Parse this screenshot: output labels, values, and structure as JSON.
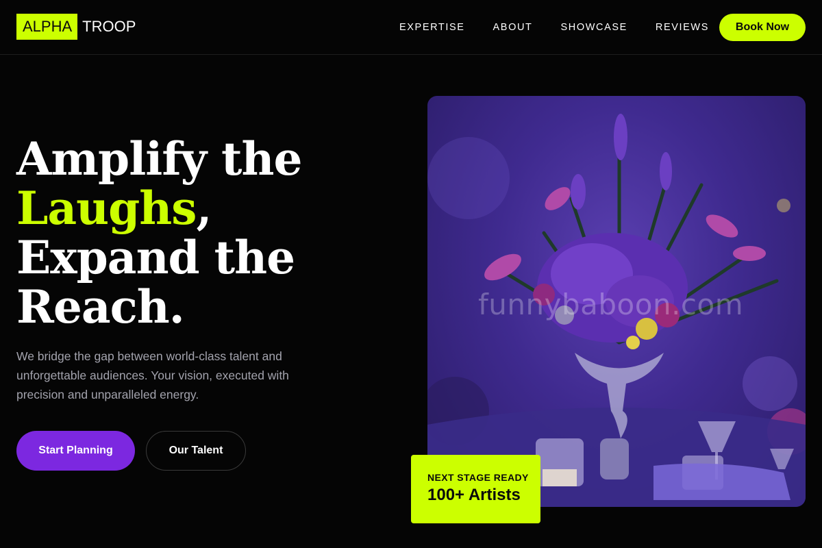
{
  "brand": {
    "logo_highlight": "ALPHA",
    "logo_rest": "TROOP",
    "accent_color": "#ccff00"
  },
  "nav": {
    "items": [
      {
        "label": "EXPERTISE"
      },
      {
        "label": "ABOUT"
      },
      {
        "label": "SHOWCASE"
      },
      {
        "label": "REVIEWS"
      }
    ],
    "cta": "Book Now"
  },
  "hero": {
    "title_line1": "Amplify the",
    "title_accent": "Laughs",
    "title_accent_suffix": ",",
    "title_line3": "Expand the",
    "title_line4": "Reach.",
    "description": "We bridge the gap between world-class talent and unforgettable audiences. Your vision, executed with precision and unparalleled energy.",
    "primary_button": "Start Planning",
    "secondary_button": "Our Talent",
    "primary_color": "#7c28e0"
  },
  "image": {
    "subject": "purple floral centerpiece with glassware",
    "watermark": "funnybaboon.com"
  },
  "stat": {
    "label": "NEXT STAGE READY",
    "value": "100+ Artists"
  }
}
